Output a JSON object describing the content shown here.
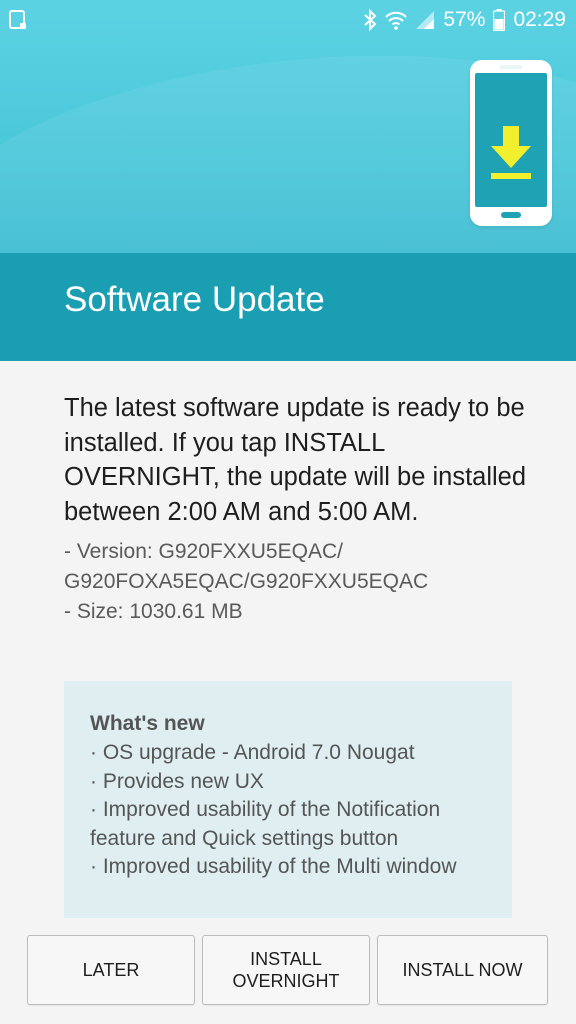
{
  "status_bar": {
    "battery": "57%",
    "time": "02:29"
  },
  "header": {
    "title": "Software Update"
  },
  "description": "The latest software update is ready to be installed. If you tap INSTALL OVERNIGHT, the update will be installed between 2:00 AM and 5:00 AM.",
  "details": {
    "version_line1": " - Version: G920FXXU5EQAC/",
    "version_line2": "G920FOXA5EQAC/G920FXXU5EQAC",
    "size": " - Size: 1030.61 MB"
  },
  "whats_new": {
    "heading": "What's new",
    "items": [
      "· OS upgrade - Android 7.0 Nougat",
      "· Provides new UX",
      "· Improved usability of the Notification feature and Quick settings button",
      "· Improved usability of the Multi window"
    ]
  },
  "buttons": {
    "later": "LATER",
    "install_overnight_line1": "INSTALL",
    "install_overnight_line2": "OVERNIGHT",
    "install_now": "INSTALL NOW"
  },
  "colors": {
    "hero_top": "#5cd3e3",
    "title_band": "#1a9fb2",
    "download_arrow": "#f1ef2e"
  }
}
